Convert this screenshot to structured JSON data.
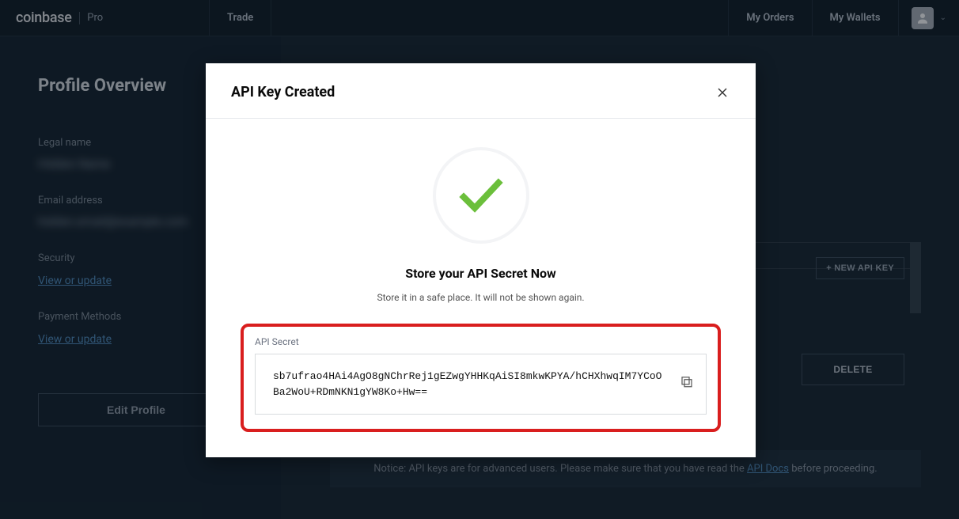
{
  "brand": {
    "name": "coinbase",
    "sub": "Pro"
  },
  "nav": {
    "trade": "Trade",
    "my_orders": "My Orders",
    "my_wallets": "My Wallets"
  },
  "sidebar": {
    "title": "Profile Overview",
    "legal_name_label": "Legal name",
    "legal_name_value": "Hidden Name",
    "email_label": "Email address",
    "email_value": "hidden.email@example.com",
    "security_label": "Security",
    "security_link": "View or update",
    "payment_label": "Payment Methods",
    "payment_link": "View or update",
    "edit_button": "Edit Profile"
  },
  "main": {
    "new_api_key": "+ NEW API KEY",
    "delete": "DELETE",
    "notice_prefix": "Notice: API keys are for advanced users. Please make sure that you have read the ",
    "notice_link": "API Docs",
    "notice_suffix": " before proceeding."
  },
  "modal": {
    "title": "API Key Created",
    "subtitle": "Store your API Secret Now",
    "hint": "Store it in a safe place. It will not be shown again.",
    "secret_label": "API Secret",
    "secret_value": "sb7ufrao4HAi4AgO8gNChrRej1gEZwgYHHKqAiSI8mkwKPYA/hCHXhwqIM7YCoOBa2WoU+RDmNKN1gYW8Ko+Hw=="
  }
}
